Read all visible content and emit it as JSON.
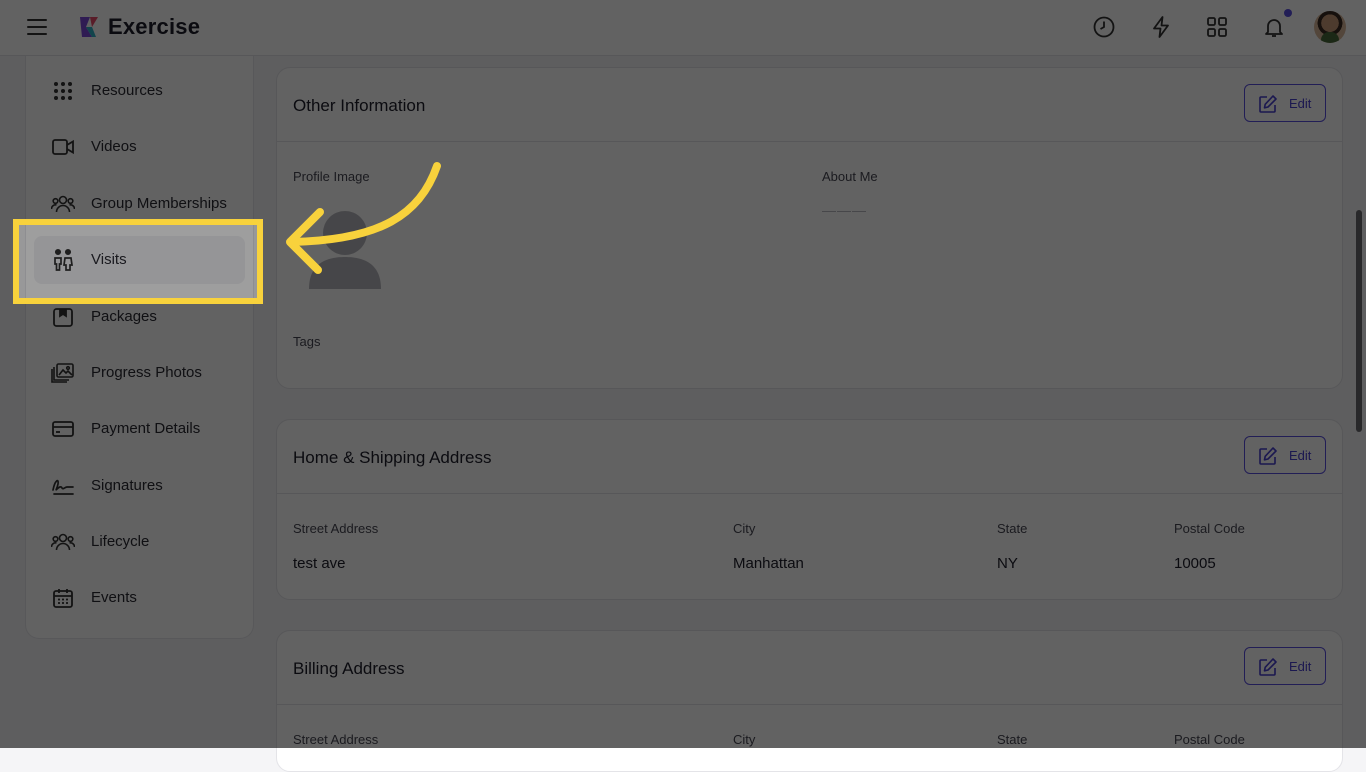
{
  "app": {
    "title": "Exercise"
  },
  "sidebar": {
    "items": [
      {
        "label": "Resources",
        "icon": "grid-dots-icon"
      },
      {
        "label": "Videos",
        "icon": "video-camera-icon"
      },
      {
        "label": "Group Memberships",
        "icon": "group-icon"
      },
      {
        "label": "Visits",
        "icon": "visits-icon",
        "active": true
      },
      {
        "label": "Packages",
        "icon": "package-icon"
      },
      {
        "label": "Progress Photos",
        "icon": "photos-icon"
      },
      {
        "label": "Payment Details",
        "icon": "credit-card-icon"
      },
      {
        "label": "Signatures",
        "icon": "signature-icon"
      },
      {
        "label": "Lifecycle",
        "icon": "group-icon"
      },
      {
        "label": "Events",
        "icon": "calendar-icon"
      }
    ]
  },
  "other_info": {
    "title": "Other Information",
    "edit_label": "Edit",
    "profile_image_label": "Profile Image",
    "about_me_label": "About Me",
    "about_me_value": "———",
    "tags_label": "Tags"
  },
  "home_address": {
    "title": "Home & Shipping Address",
    "edit_label": "Edit",
    "street_label": "Street Address",
    "street_value": "test ave",
    "city_label": "City",
    "city_value": "Manhattan",
    "state_label": "State",
    "state_value": "NY",
    "postal_label": "Postal Code",
    "postal_value": "10005"
  },
  "billing_address": {
    "title": "Billing Address",
    "edit_label": "Edit",
    "street_label": "Street Address",
    "city_label": "City",
    "state_label": "State",
    "postal_label": "Postal Code"
  },
  "colors": {
    "accent": "#5b4fe0",
    "highlight": "#f8d23c"
  }
}
